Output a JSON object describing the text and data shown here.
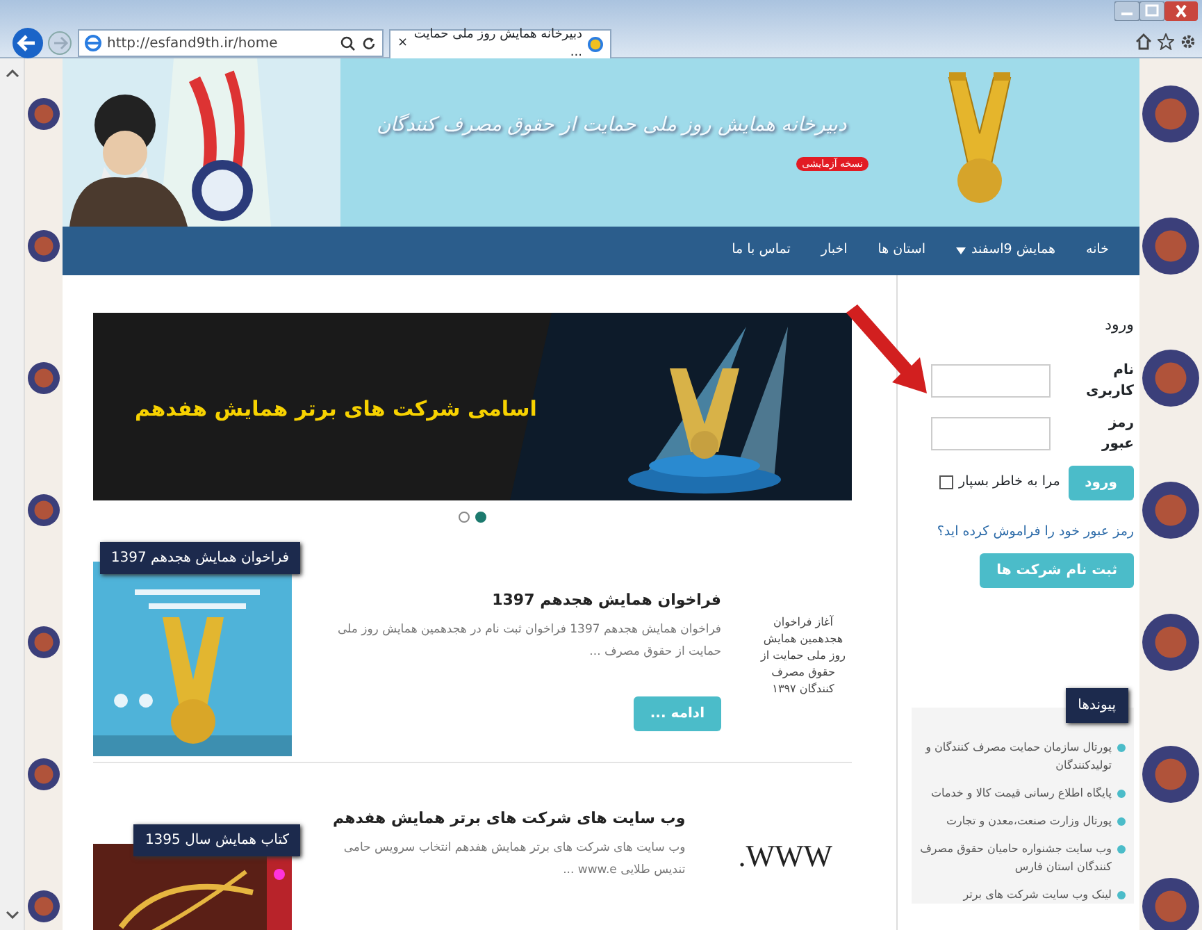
{
  "browser": {
    "address": "http://esfand9th.ir/home",
    "tab": {
      "title": "دبیرخانه همایش روز ملی حمایت ...",
      "close": "×"
    }
  },
  "header": {
    "title": "دبیرخانه همایش روز ملی حمایت از حقوق مصرف کنندگان",
    "badge": "نسخه آزمایشی"
  },
  "nav": [
    {
      "label": "خانه",
      "dropdown": false
    },
    {
      "label": "همایش 9اسفند",
      "dropdown": true
    },
    {
      "label": "استان ها",
      "dropdown": false
    },
    {
      "label": "اخبار",
      "dropdown": false
    },
    {
      "label": "تماس با ما",
      "dropdown": false
    }
  ],
  "slider": {
    "caption": "اسامی شرکت های برتر همایش هفدهم",
    "dots": [
      {
        "selected": true
      },
      {
        "selected": false
      }
    ]
  },
  "posts": [
    {
      "title": "فراخوان همایش هجدهم 1397",
      "excerpt": "فراخوان همایش هجدهم 1397 فراخوان ثبت نام در هجدهمین همایش روز ملی حمایت از حقوق مصرف ...",
      "thumb_text": "آغاز فراخوان هجدهمین همایش روز ملی حمایت از حقوق مصرف کنندگان ۱۳۹۷",
      "button": "ادامه ...",
      "featured": {
        "label": "فراخوان همایش هجدهم 1397",
        "kind": "poster"
      }
    },
    {
      "title": "وب سایت های شرکت های برتر همایش هفدهم",
      "excerpt": "وب سایت های شرکت های برتر همایش هفدهم انتخاب سرویس حامی تندیس طلایی www.e ...",
      "thumb_text": "WWW.",
      "featured": {
        "label": "کتاب همایش سال 1395",
        "kind": "book"
      }
    }
  ],
  "login": {
    "title": "ورود",
    "username_label": "نام کاربری",
    "password_label": "رمز عبور",
    "submit": "ورود",
    "remember": {
      "label": "مرا به خاطر بسپار",
      "checked": false
    },
    "forgot": "رمز عبور خود را فراموش کرده اید؟",
    "register": "ثبت نام شرکت ها"
  },
  "links": {
    "title": "پیوندها",
    "items": [
      "پورتال سازمان حمایت مصرف کنندگان و تولیدکنندگان",
      "پایگاه اطلاع رسانی قیمت کالا و خدمات",
      "پورتال وزارت صنعت،معدن و تجارت",
      "وب سایت جشنواره حامیان حقوق مصرف کنندگان استان فارس",
      "لینک وب سایت شرکت های برتر"
    ]
  }
}
